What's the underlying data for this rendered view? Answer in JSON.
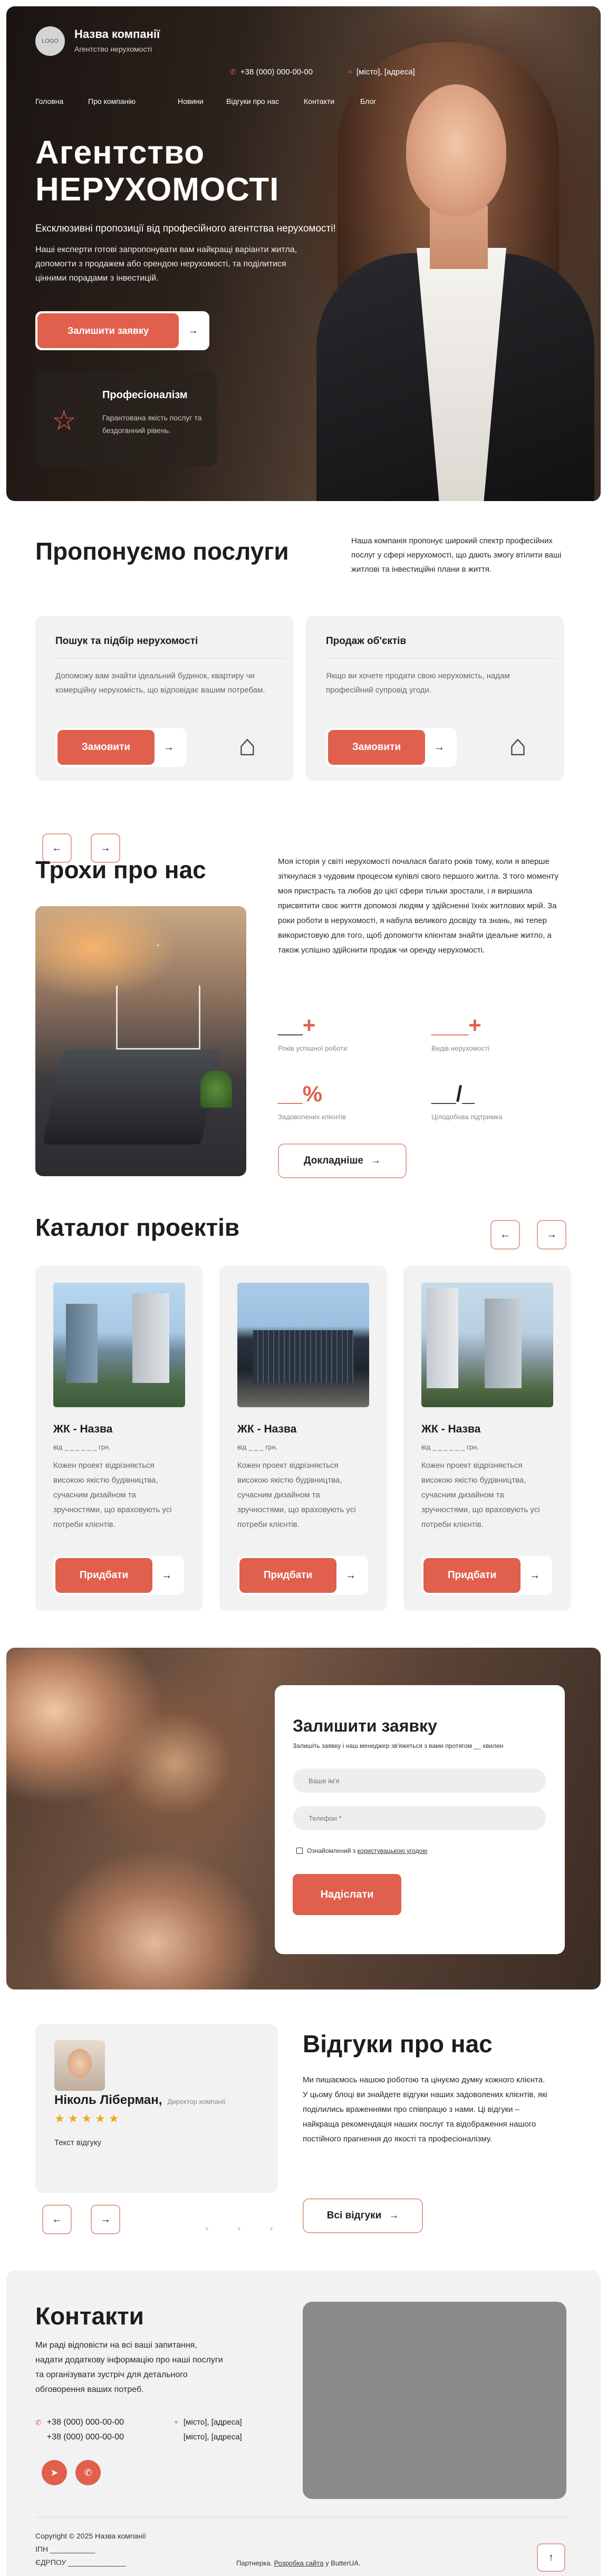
{
  "header": {
    "logo_text": "LOGO",
    "company_name": "Назва компанії",
    "company_sub": "Агентство нерухомості",
    "phone": "+38 (000) 000-00-00",
    "address": "[місто], [адреса]",
    "nav": [
      "Головна",
      "Про компанію",
      "Новини",
      "Відгуки про нас",
      "Контакти",
      "Блог"
    ]
  },
  "hero": {
    "title_line1": "Агентство",
    "title_line2": "НЕРУХОМОСТІ",
    "lead": "Ексклюзивні пропозиції від професійного агентства нерухомості!",
    "desc": "Наші експерти готові запропонувати вам найкращі варіанти житла, допомогти з продажем або орендою нерухомості, та поділитися цінними порадами з інвестицій.",
    "cta": "Залишити заявку",
    "feature_title": "Професіоналізм",
    "feature_text": "Гарантована якість послуг та бездоганний рівень."
  },
  "services": {
    "title": "Пропонуємо послуги",
    "intro": "Наша компанія пропонує широкий спектр професійних послуг у сфері нерухомості, що дають змогу втілити ваші житлові та інвестиційні плани в життя.",
    "cards": [
      {
        "title": "Пошук та підбір нерухомості",
        "text": "Допоможу вам знайти ідеальний будинок, квартиру чи комерційну нерухомість, що відповідає вашим потребам.",
        "button": "Замовити"
      },
      {
        "title": "Продаж об'єктів",
        "text": "Якщо ви хочете продати свою нерухомість, надам професійний супровід угоди.",
        "button": "Замовити"
      }
    ]
  },
  "about": {
    "title": "Трохи про нас",
    "text": "Моя історія у світі нерухомості почалася багато років тому, коли я вперше зіткнулася з чудовим процесом купівлі свого першого житла. З того моменту моя пристрасть та любов до цієї сфери тільки зростали, і я вирішила присвятити своє життя допомозі людям у здійсненні їхніх житлових мрій. За роки роботи в нерухомості, я набула великого досвіду та знань, які тепер використовую для того, щоб допомогти клієнтам знайти ідеальне житло, а також успішно здійснити продаж чи оренду нерухомості.",
    "stats": [
      {
        "num": "__",
        "acc": "+",
        "label": "Років успішної роботи"
      },
      {
        "num": "___",
        "acc": "+",
        "label": "Видів нерухомості"
      },
      {
        "num": "__",
        "acc": "%",
        "label": "Задоволених клієнтів",
        "accent_all": true
      },
      {
        "num": "__/_",
        "acc": "",
        "label": "Цілодобова підтримка"
      }
    ],
    "button": "Докладніше"
  },
  "catalog": {
    "title": "Каталог проектів",
    "items": [
      {
        "name": "ЖК - Назва",
        "price": "від _ _ _ _ _ _  грн.",
        "desc": "Кожен проект відрізняється високою якістю будівництва, сучасним дизайном та зручностями, що враховують усі потреби клієнтів.",
        "button": "Придбати"
      },
      {
        "name": "ЖК - Назва",
        "price": "від _ _ _  грн.",
        "desc": "Кожен проект відрізняється високою якістю будівництва, сучасним дизайном та зручностями, що враховують усі потреби клієнтів.",
        "button": "Придбати"
      },
      {
        "name": "ЖК - Назва",
        "price": "від _ _ _ _ _ _  грн.",
        "desc": "Кожен проект відрізняється високою якістю будівництва, сучасним дизайном та зручностями, що враховують усі потреби клієнтів.",
        "button": "Придбати"
      }
    ]
  },
  "request": {
    "title": "Залишити заявку",
    "sub": "Залишіть заявку і наш менеджер зв'яжеться з вами протягом __ хвилин",
    "name_placeholder": "Ваше ім'я",
    "phone_placeholder": "Телефон *",
    "consent_prefix": "Ознайомлений з ",
    "consent_link": "користувацькою угодою",
    "button": "Надіслати"
  },
  "reviews": {
    "title": "Відгуки про нас",
    "name": "Ніколь Ліберман,",
    "role": "Директор компанії",
    "stars": "★★★★★",
    "text": "Текст відгуку",
    "desc": "Ми пишаємось нашою роботою та цінуємо думку кожного клієнта. У цьому блоці ви знайдете відгуки наших задоволених клієнтів, які поділились враженнями про співпрацю з нами. Ці відгуки – найкраща рекомендація наших послуг та відображення нашого постійного прагнення до якості та професіоналізму.",
    "button": "Всі відгуки"
  },
  "contacts": {
    "title": "Контакти",
    "desc": "Ми раді відповісти на всі ваші запитання, надати додаткову інформацію про наші послуги та організувати зустріч для детального обговорення ваших потреб.",
    "phone1": "+38 (000) 000-00-00",
    "phone2": "+38 (000) 000-00-00",
    "addr1": "[місто], [адреса]",
    "addr2": "[місто], [адреса]",
    "copyright": "Copyright © 2025 Назва компанії",
    "ipn": "ІПН ___________",
    "edrpou": "ЄДРПОУ ______________",
    "privacy_prefix": "Партнерка. ",
    "privacy_link": "Розробка сайта",
    "privacy_suffix": " у ButterUA."
  },
  "colors": {
    "accent": "#e0604d",
    "card_bg": "#f2f2f2",
    "text": "#1d1d1f"
  }
}
